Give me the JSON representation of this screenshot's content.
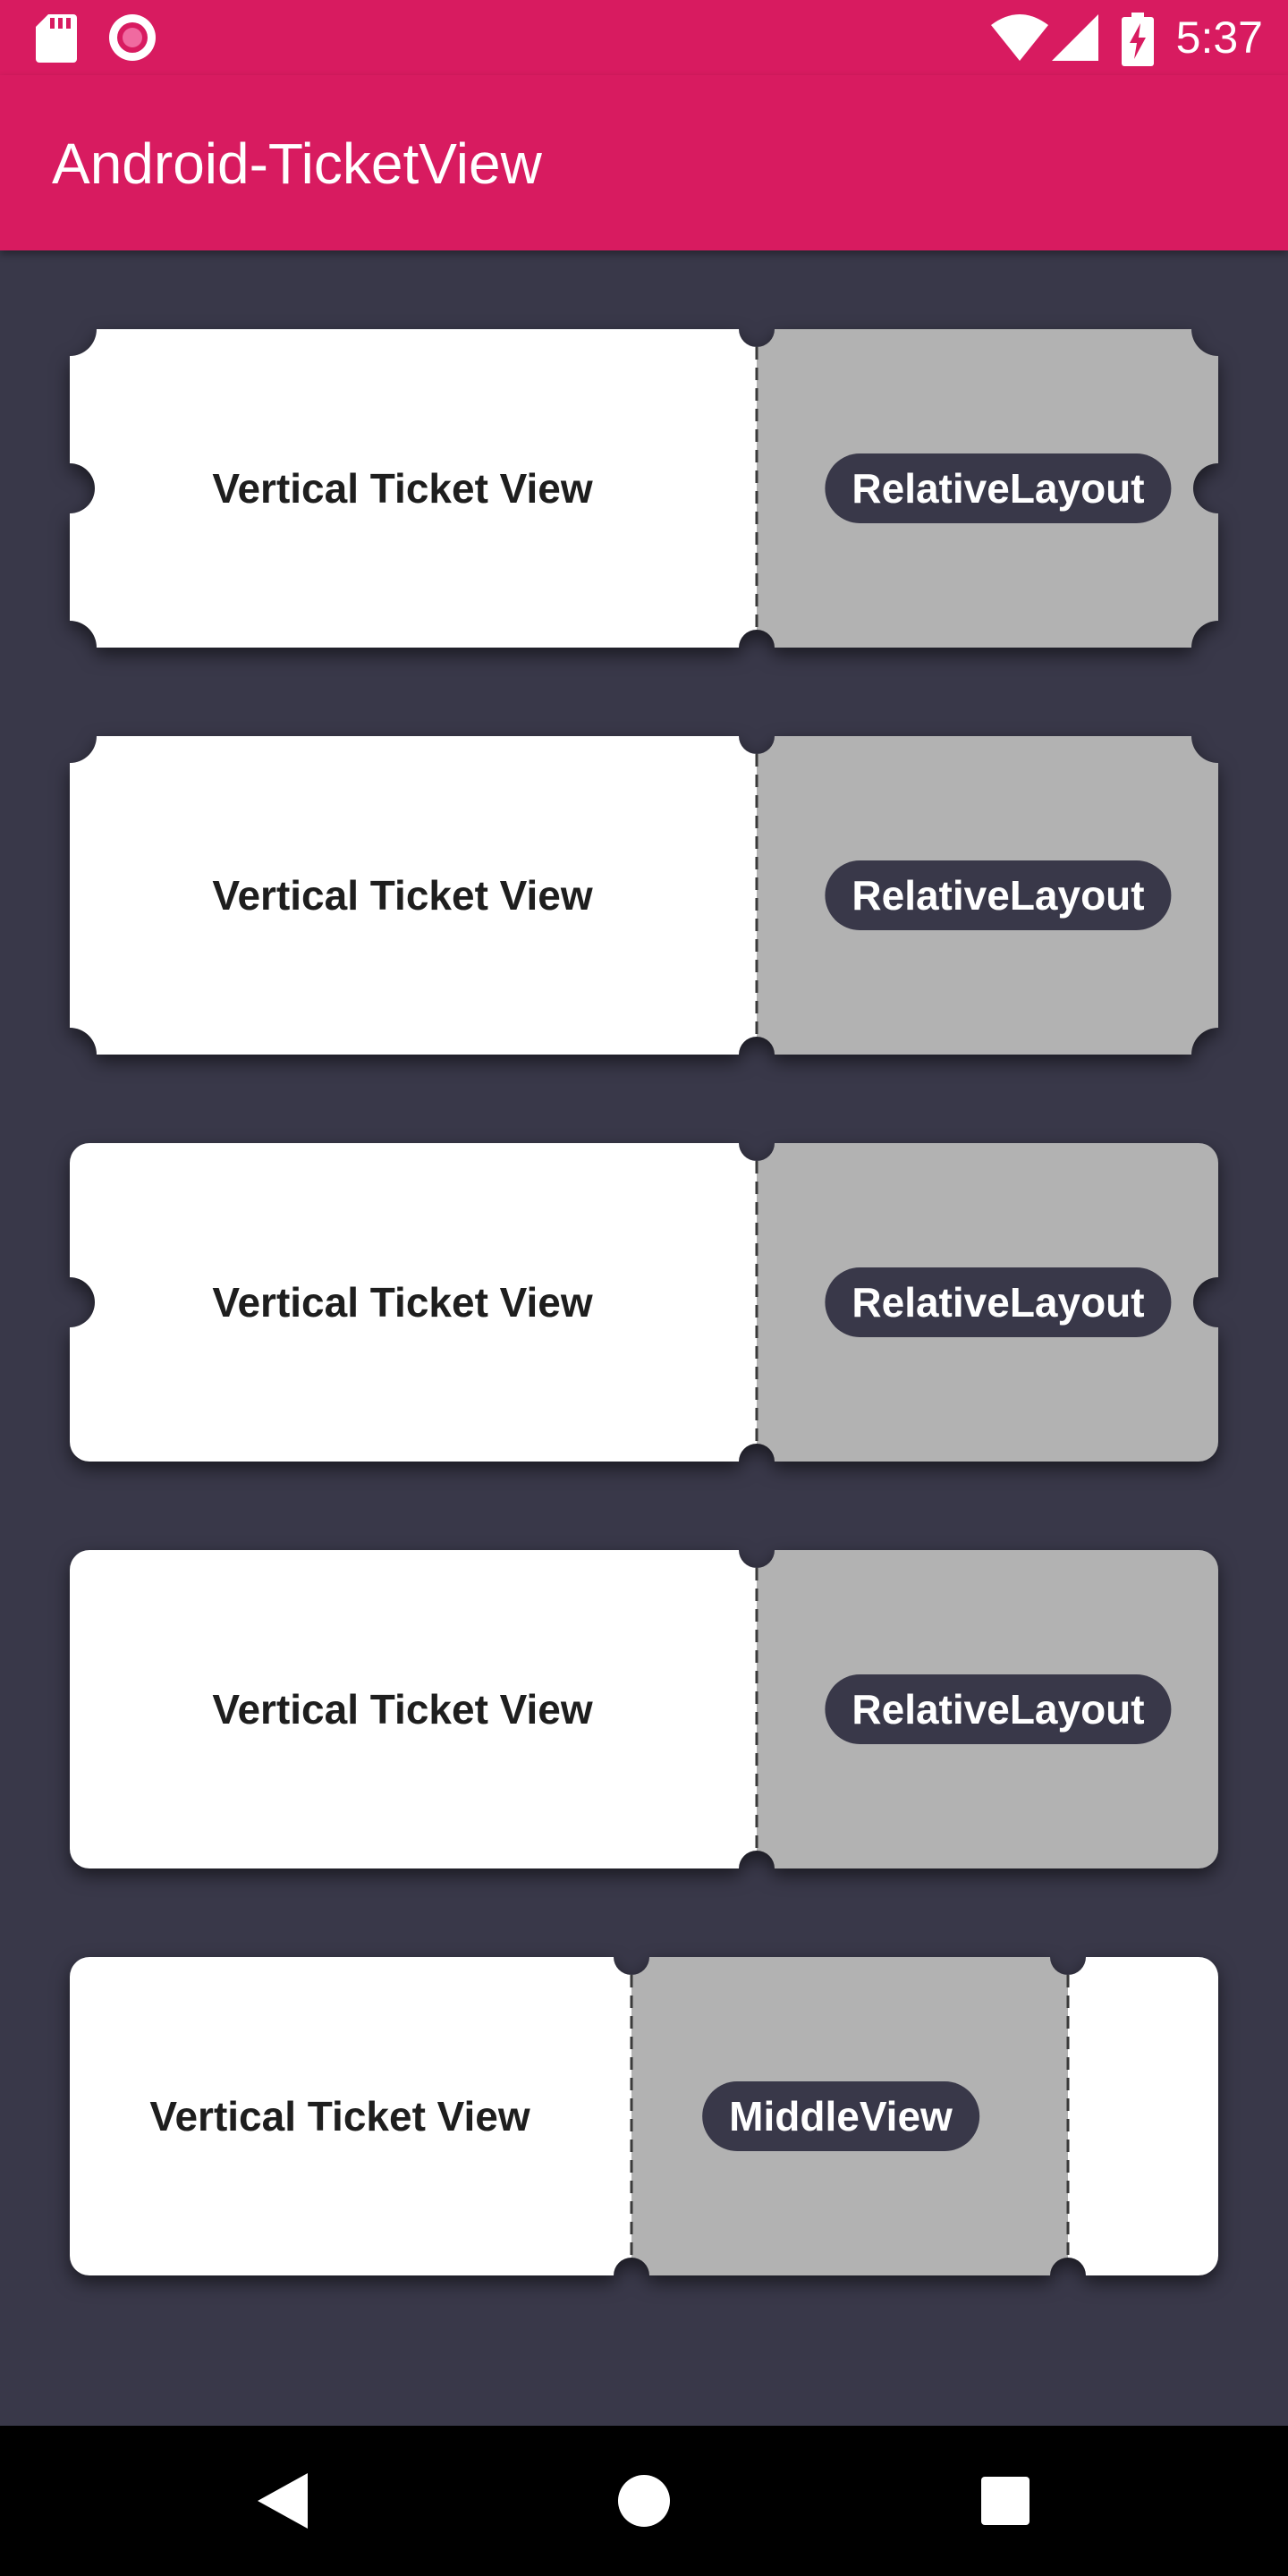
{
  "status_bar": {
    "time": "5:37",
    "left_icons": [
      "sd-card-icon",
      "record-icon"
    ],
    "right_icons": [
      "wifi-icon",
      "signal-icon",
      "battery-charging-icon"
    ]
  },
  "app_bar": {
    "title": "Android-TicketView"
  },
  "tickets": [
    {
      "label": "Vertical Ticket View",
      "chip": "RelativeLayout"
    },
    {
      "label": "Vertical Ticket View",
      "chip": "RelativeLayout"
    },
    {
      "label": "Vertical Ticket View",
      "chip": "RelativeLayout"
    },
    {
      "label": "Vertical Ticket View",
      "chip": "RelativeLayout"
    },
    {
      "label": "Vertical Ticket View",
      "chip": "MiddleView"
    }
  ],
  "nav_bar": {
    "buttons": [
      "back-icon",
      "home-icon",
      "recents-icon"
    ]
  },
  "colors": {
    "accent": "#D81B60",
    "background": "#393849",
    "ticket_white": "#FFFFFF",
    "ticket_grey": "#B2B2B2",
    "chip_bg": "#393849"
  }
}
